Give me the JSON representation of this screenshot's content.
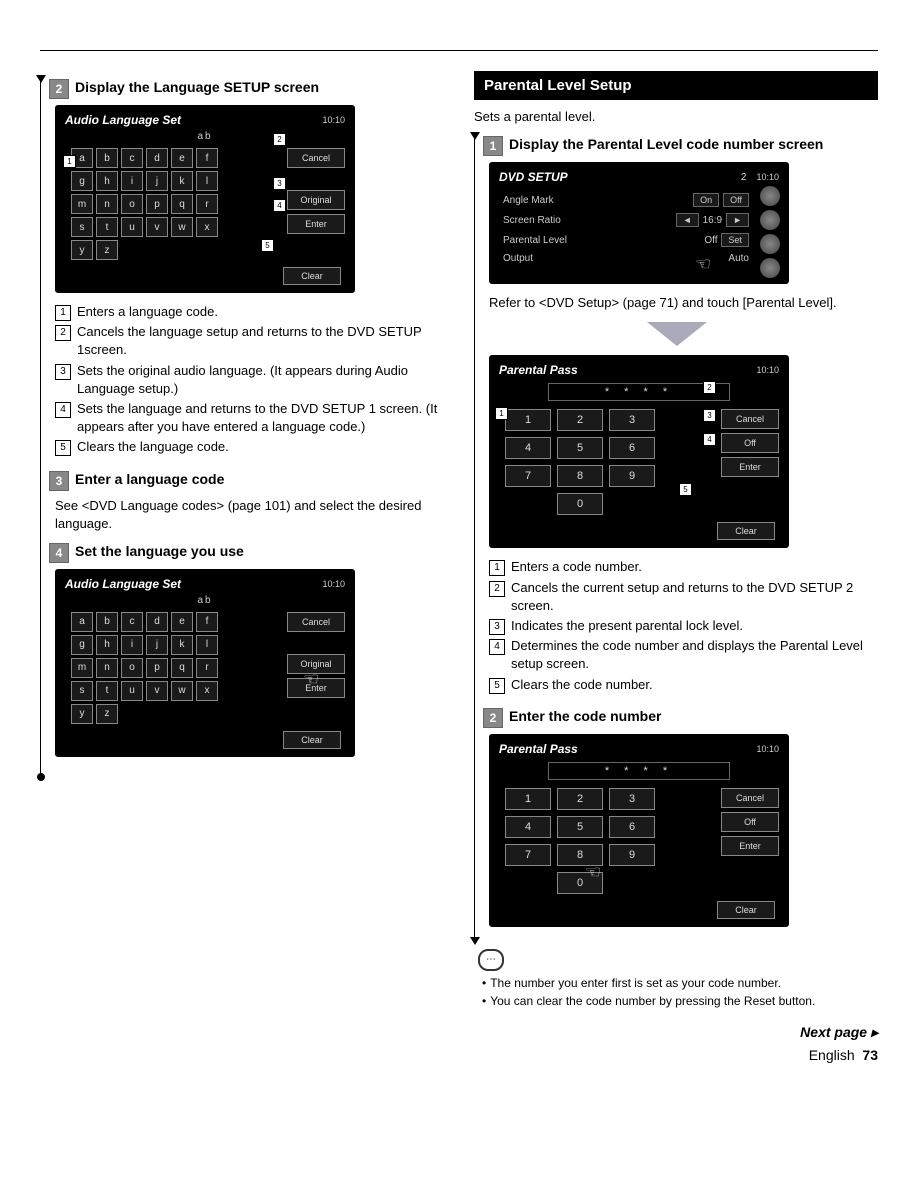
{
  "left": {
    "step2": {
      "num": "2",
      "title": "Display the Language SETUP screen"
    },
    "screen1": {
      "title": "Audio Language Set",
      "time": "10:10",
      "entered": "ab",
      "keys_row1": [
        "a",
        "b",
        "c",
        "d",
        "e",
        "f"
      ],
      "keys_row2": [
        "g",
        "h",
        "i",
        "j",
        "k",
        "l"
      ],
      "keys_row3": [
        "m",
        "n",
        "o",
        "p",
        "q",
        "r"
      ],
      "keys_row4": [
        "s",
        "t",
        "u",
        "v",
        "w",
        "x"
      ],
      "keys_row5": [
        "y",
        "z"
      ],
      "btn_cancel": "Cancel",
      "btn_original": "Original",
      "btn_enter": "Enter",
      "btn_clear": "Clear"
    },
    "callouts1": {
      "c1": "Enters a language code.",
      "c2": "Cancels the language setup and returns to the DVD SETUP 1screen.",
      "c3": "Sets the original audio language. (It appears during Audio Language setup.)",
      "c4": "Sets the language and returns to the DVD SETUP 1 screen. (It appears after you have entered a language code.)",
      "c5": "Clears the language code."
    },
    "step3": {
      "num": "3",
      "title": "Enter a language code"
    },
    "body3": "See <DVD Language codes> (page 101) and select the desired language.",
    "step4": {
      "num": "4",
      "title": "Set the language you use"
    },
    "screen2": {
      "title": "Audio Language Set",
      "time": "10:10",
      "entered": "ab",
      "keys_row1": [
        "a",
        "b",
        "c",
        "d",
        "e",
        "f"
      ],
      "keys_row2": [
        "g",
        "h",
        "i",
        "j",
        "k",
        "l"
      ],
      "keys_row3": [
        "m",
        "n",
        "o",
        "p",
        "q",
        "r"
      ],
      "keys_row4": [
        "s",
        "t",
        "u",
        "v",
        "w",
        "x"
      ],
      "keys_row5": [
        "y",
        "z"
      ],
      "btn_cancel": "Cancel",
      "btn_original": "Original",
      "btn_enter": "Enter",
      "btn_clear": "Clear"
    }
  },
  "right": {
    "section_title": "Parental Level Setup",
    "intro": "Sets a parental level.",
    "step1": {
      "num": "1",
      "title": "Display the Parental Level code number screen"
    },
    "dvd_setup": {
      "title": "DVD SETUP",
      "tab": "2",
      "time": "10:10",
      "row1_label": "Angle Mark",
      "row1_on": "On",
      "row1_off": "Off",
      "row2_label": "Screen Ratio",
      "row2_val": "16:9",
      "row3_label": "Parental Level",
      "row3_val": "Off",
      "row3_set": "Set",
      "row4_label": "Output",
      "row4_val": "Auto"
    },
    "body1": "Refer to <DVD Setup> (page 71) and touch [Parental Level].",
    "parental_pass": {
      "title": "Parental Pass",
      "time": "10:10",
      "stars": "* * * *",
      "keys": [
        "1",
        "2",
        "3",
        "4",
        "5",
        "6",
        "7",
        "8",
        "9",
        "0"
      ],
      "btn_cancel": "Cancel",
      "btn_off": "Off",
      "btn_enter": "Enter",
      "btn_clear": "Clear"
    },
    "callouts2": {
      "c1": "Enters a code number.",
      "c2": "Cancels the current setup and returns to the DVD SETUP 2 screen.",
      "c3": "Indicates the present parental lock level.",
      "c4": "Determines the code number and displays the Parental Level setup screen.",
      "c5": "Clears the code number."
    },
    "step2": {
      "num": "2",
      "title": "Enter the code number"
    },
    "parental_pass2": {
      "title": "Parental Pass",
      "time": "10:10",
      "stars": "* * * *",
      "keys": [
        "1",
        "2",
        "3",
        "4",
        "5",
        "6",
        "7",
        "8",
        "9",
        "0"
      ],
      "btn_cancel": "Cancel",
      "btn_off": "Off",
      "btn_enter": "Enter",
      "btn_clear": "Clear"
    },
    "notes": {
      "n1": "The number you enter first is set as your code number.",
      "n2": "You can clear the code number by pressing the Reset button."
    }
  },
  "footer": {
    "next": "Next page ▸",
    "lang": "English",
    "page": "73"
  }
}
